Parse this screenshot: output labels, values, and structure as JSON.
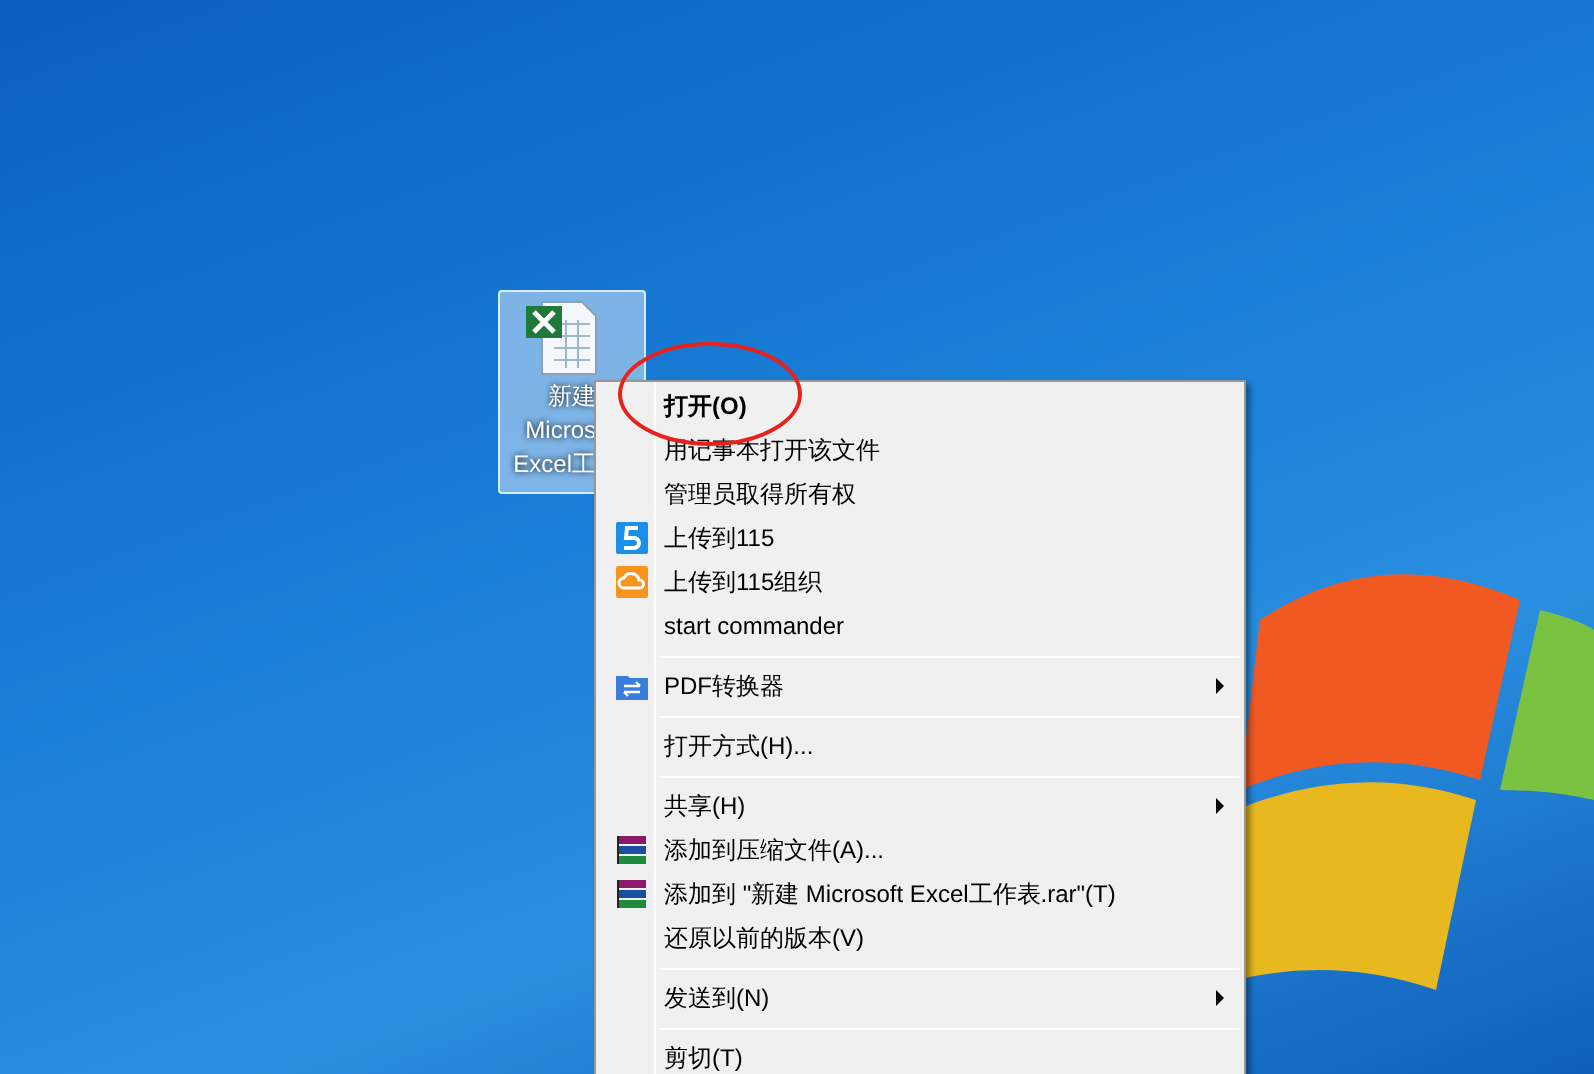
{
  "desktop_icon": {
    "label_lines": [
      "新建",
      "Micros",
      "Excel工"
    ],
    "selected": true
  },
  "context_menu": {
    "groups": [
      {
        "items": [
          {
            "label": "打开(O)",
            "bold": true,
            "submenu": false
          },
          {
            "label": "用记事本打开该文件",
            "bold": false,
            "submenu": false
          },
          {
            "label": "管理员取得所有权",
            "bold": false,
            "submenu": false
          },
          {
            "label": "上传到115",
            "bold": false,
            "kind": "s115",
            "submenu": false
          },
          {
            "label": "上传到115组织",
            "bold": false,
            "kind": "cloud",
            "submenu": false
          },
          {
            "label": "start commander",
            "bold": false,
            "submenu": false
          }
        ]
      },
      {
        "items": [
          {
            "label": "PDF转换器",
            "bold": false,
            "kind": "pdf",
            "submenu": true
          }
        ]
      },
      {
        "items": [
          {
            "label": "打开方式(H)...",
            "bold": false,
            "submenu": false
          }
        ]
      },
      {
        "items": [
          {
            "label": "共享(H)",
            "bold": false,
            "submenu": true
          },
          {
            "label": "添加到压缩文件(A)...",
            "bold": false,
            "kind": "rar",
            "submenu": false
          },
          {
            "label": "添加到 \"新建 Microsoft Excel工作表.rar\"(T)",
            "bold": false,
            "kind": "rar",
            "submenu": false
          },
          {
            "label": "还原以前的版本(V)",
            "bold": false,
            "submenu": false
          }
        ]
      },
      {
        "items": [
          {
            "label": "发送到(N)",
            "bold": false,
            "submenu": true
          }
        ]
      },
      {
        "items": [
          {
            "label": "剪切(T)",
            "bold": false,
            "submenu": false
          }
        ]
      }
    ]
  }
}
